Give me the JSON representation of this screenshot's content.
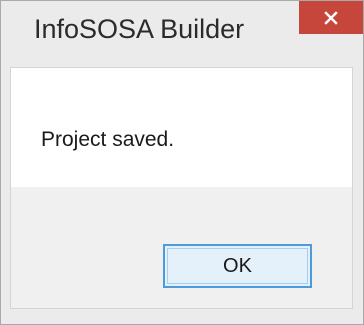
{
  "window": {
    "title": "InfoSOSA Builder"
  },
  "titlebar": {
    "close_icon": "close-icon",
    "close_color": "#c7463c"
  },
  "dialog": {
    "message": "Project saved.",
    "ok_label": "OK"
  }
}
